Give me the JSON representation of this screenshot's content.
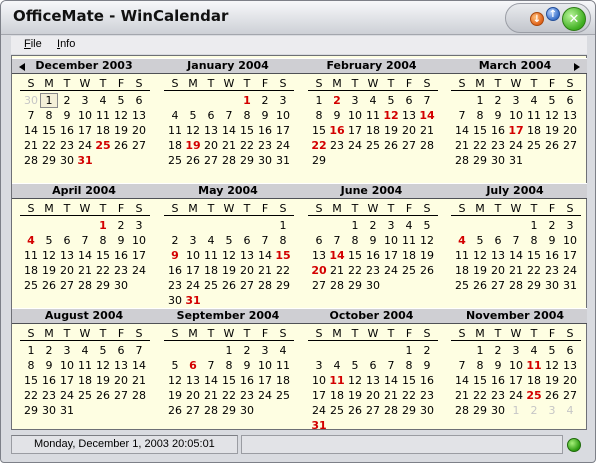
{
  "window": {
    "title": "OfficeMate - WinCalendar",
    "buttons": {
      "minimize": "↓",
      "maximize": "↑",
      "close": "✕"
    }
  },
  "menu": [
    {
      "label": "File",
      "accel": "F",
      "rest": "ile"
    },
    {
      "label": "Info",
      "accel": "I",
      "rest": "nfo"
    }
  ],
  "weekday_labels": [
    "S",
    "M",
    "T",
    "W",
    "T",
    "F",
    "S"
  ],
  "nav": {
    "prev_icon": "triangle-left-icon",
    "next_icon": "triangle-right-icon"
  },
  "months": [
    {
      "name": "December 2003",
      "first_weekday": 1,
      "days": 31,
      "red": [
        25,
        31
      ],
      "today": 1,
      "prev_tail": [
        30
      ],
      "next_head": []
    },
    {
      "name": "January 2004",
      "first_weekday": 4,
      "days": 31,
      "red": [
        1,
        19
      ],
      "today": null,
      "prev_tail": [],
      "next_head": []
    },
    {
      "name": "February 2004",
      "first_weekday": 0,
      "days": 29,
      "red": [
        2,
        12,
        14,
        16,
        22
      ],
      "today": null,
      "prev_tail": [],
      "next_head": []
    },
    {
      "name": "March 2004",
      "first_weekday": 1,
      "days": 31,
      "red": [
        17
      ],
      "today": null,
      "prev_tail": [],
      "next_head": []
    },
    {
      "name": "April 2004",
      "first_weekday": 4,
      "days": 30,
      "red": [
        1,
        4
      ],
      "today": null,
      "prev_tail": [],
      "next_head": []
    },
    {
      "name": "May 2004",
      "first_weekday": 6,
      "days": 31,
      "red": [
        9,
        15,
        31
      ],
      "today": null,
      "prev_tail": [],
      "next_head": []
    },
    {
      "name": "June 2004",
      "first_weekday": 2,
      "days": 30,
      "red": [
        14,
        20
      ],
      "today": null,
      "prev_tail": [],
      "next_head": []
    },
    {
      "name": "July 2004",
      "first_weekday": 4,
      "days": 31,
      "red": [
        4
      ],
      "today": null,
      "prev_tail": [],
      "next_head": []
    },
    {
      "name": "August 2004",
      "first_weekday": 0,
      "days": 31,
      "red": [],
      "today": null,
      "prev_tail": [],
      "next_head": []
    },
    {
      "name": "September 2004",
      "first_weekday": 3,
      "days": 30,
      "red": [
        6
      ],
      "today": null,
      "prev_tail": [],
      "next_head": []
    },
    {
      "name": "October 2004",
      "first_weekday": 5,
      "days": 31,
      "red": [
        11,
        31
      ],
      "today": null,
      "prev_tail": [],
      "next_head": []
    },
    {
      "name": "November 2004",
      "first_weekday": 1,
      "days": 30,
      "red": [
        11,
        25
      ],
      "today": null,
      "prev_tail": [],
      "next_head": [
        1,
        2,
        3,
        4
      ]
    }
  ],
  "colors": {
    "holiday": "#d30000",
    "other_month": "#c6c6c6",
    "calendar_bg": "#fefee2",
    "header_bg": "#cfcfd3"
  },
  "status": {
    "datetime": "Monday, December 1, 2003   20:05:01",
    "indicator_icon": "green-led-icon"
  }
}
